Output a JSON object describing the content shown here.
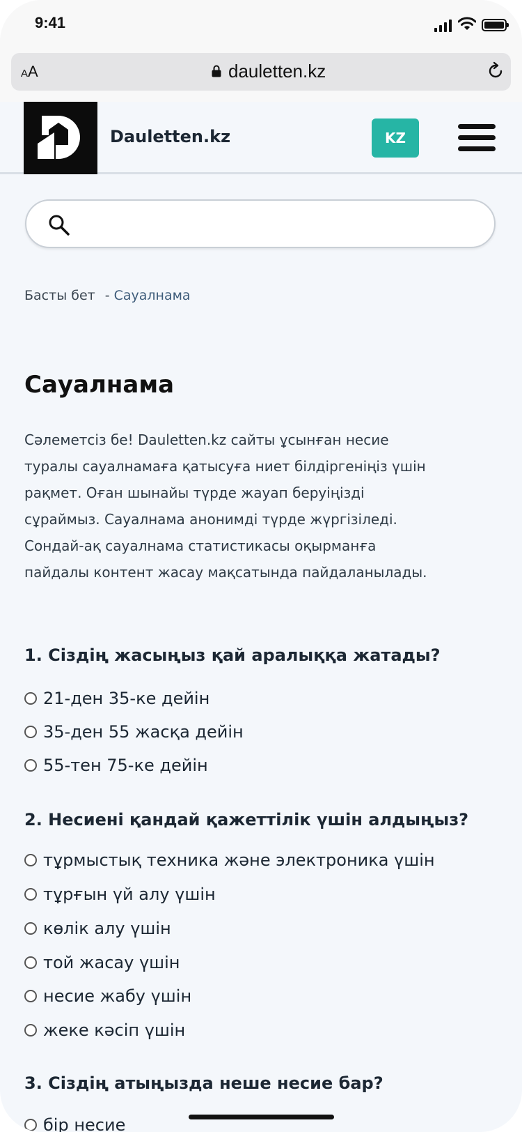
{
  "status_bar": {
    "time": "9:41"
  },
  "browser": {
    "text_size": "AA",
    "url": "dauletten.kz"
  },
  "header": {
    "site_name": "Dauletten.kz",
    "lang_button": "KZ"
  },
  "search": {
    "placeholder": ""
  },
  "breadcrumb": {
    "home": "Басты бет",
    "separator": "-",
    "current": "Сауалнама"
  },
  "page": {
    "title": "Сауалнама",
    "intro_lines": [
      "Сәлеметсіз бе! Dauletten.kz сайты ұсынған несие",
      "туралы сауалнамаға қатысуға ниет білдіргеніңіз үшін",
      "рақмет. Оған шынайы түрде жауап беруіңізді",
      "сұраймыз. Сауалнама анонимді түрде жүргізіледі.",
      "Сондай-ақ сауалнама статистикасы оқырманға",
      "пайдалы контент жасау мақсатында пайдаланылады."
    ]
  },
  "questions": [
    {
      "text": "1. Сіздің жасыңыз қай аралыққа жатады?",
      "options": [
        "21-ден 35-ке дейін",
        "35-ден 55 жасқа дейін",
        "55-тен 75-ке дейін"
      ]
    },
    {
      "text": "2. Несиені қандай қажеттілік үшін алдыңыз?",
      "options": [
        "тұрмыстық техника және электроника үшін",
        "тұрғын үй алу үшін",
        "көлік алу үшін",
        "той жасау үшін",
        "несие жабу үшін",
        "жеке кәсіп үшін"
      ]
    },
    {
      "text": "3. Сіздің атыңызда неше несие бар?",
      "options": [
        "бір несие"
      ]
    }
  ]
}
